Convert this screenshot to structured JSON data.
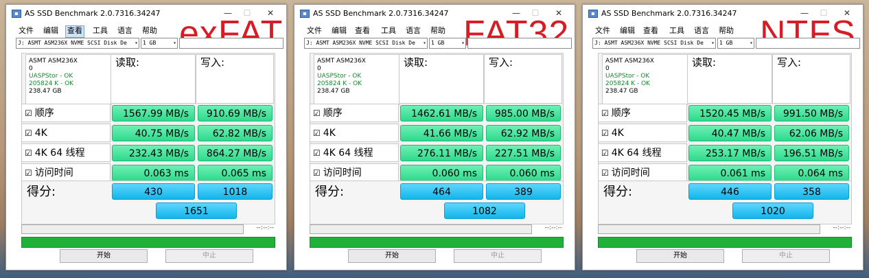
{
  "windows": [
    {
      "title": "AS SSD Benchmark 2.0.7316.34247",
      "menu": [
        "文件",
        "编辑",
        "查看",
        "工具",
        "语言",
        "帮助"
      ],
      "active_menu_index": 2,
      "label": "exFAT",
      "drive_select": "J: ASMT ASM236X NVME SCSI Disk De",
      "size_select": "1 GB",
      "device": {
        "name": "ASMT ASM236X",
        "line2": "0",
        "driver": "UASPStor - OK",
        "align": "205824 K - OK",
        "capacity": "238.47 GB"
      },
      "col_read": "读取:",
      "col_write": "写入:",
      "rows": [
        {
          "check": "☑",
          "label": "顺序",
          "read": "1567.99 MB/s",
          "write": "910.69 MB/s"
        },
        {
          "check": "☑",
          "label": "4K",
          "read": "40.75 MB/s",
          "write": "62.82 MB/s"
        },
        {
          "check": "☑",
          "label": "4K 64 线程",
          "read": "232.43 MB/s",
          "write": "864.27 MB/s"
        },
        {
          "check": "☑",
          "label": "访问时间",
          "read": "0.063 ms",
          "write": "0.065 ms"
        }
      ],
      "score_label": "得分:",
      "score_read": "430",
      "score_write": "1018",
      "score_total": "1651",
      "timer": "--:--:--",
      "start_button": "开始",
      "stop_button": "中止"
    },
    {
      "title": "AS SSD Benchmark 2.0.7316.34247",
      "menu": [
        "文件",
        "编辑",
        "查看",
        "工具",
        "语言",
        "帮助"
      ],
      "active_menu_index": -1,
      "label": "FAT32",
      "drive_select": "J: ASMT ASM236X NVME SCSI Disk De",
      "size_select": "1 GB",
      "device": {
        "name": "ASMT ASM236X",
        "line2": "0",
        "driver": "UASPStor - OK",
        "align": "205824 K - OK",
        "capacity": "238.47 GB"
      },
      "col_read": "读取:",
      "col_write": "写入:",
      "rows": [
        {
          "check": "☑",
          "label": "顺序",
          "read": "1462.61 MB/s",
          "write": "985.00 MB/s"
        },
        {
          "check": "☑",
          "label": "4K",
          "read": "41.66 MB/s",
          "write": "62.92 MB/s"
        },
        {
          "check": "☑",
          "label": "4K 64 线程",
          "read": "276.11 MB/s",
          "write": "227.51 MB/s"
        },
        {
          "check": "☑",
          "label": "访问时间",
          "read": "0.060 ms",
          "write": "0.060 ms"
        }
      ],
      "score_label": "得分:",
      "score_read": "464",
      "score_write": "389",
      "score_total": "1082",
      "timer": "--:--:--",
      "start_button": "开始",
      "stop_button": "中止"
    },
    {
      "title": "AS SSD Benchmark 2.0.7316.34247",
      "menu": [
        "文件",
        "编辑",
        "查看",
        "工具",
        "语言",
        "帮助"
      ],
      "active_menu_index": -1,
      "label": "NTFS",
      "drive_select": "J: ASMT ASM236X NVME SCSI Disk De",
      "size_select": "1 GB",
      "device": {
        "name": "ASMT ASM236X",
        "line2": "0",
        "driver": "UASPStor - OK",
        "align": "205824 K - OK",
        "capacity": "238.47 GB"
      },
      "col_read": "读取:",
      "col_write": "写入:",
      "rows": [
        {
          "check": "☑",
          "label": "顺序",
          "read": "1520.45 MB/s",
          "write": "991.50 MB/s"
        },
        {
          "check": "☑",
          "label": "4K",
          "read": "40.47 MB/s",
          "write": "62.06 MB/s"
        },
        {
          "check": "☑",
          "label": "4K 64 线程",
          "read": "253.17 MB/s",
          "write": "196.51 MB/s"
        },
        {
          "check": "☑",
          "label": "访问时间",
          "read": "0.061 ms",
          "write": "0.064 ms"
        }
      ],
      "score_label": "得分:",
      "score_read": "446",
      "score_write": "358",
      "score_total": "1020",
      "timer": "--:--:--",
      "start_button": "开始",
      "stop_button": "中止"
    }
  ],
  "colors": {
    "label_red": "#d81c25",
    "result_green": "#2fd98c",
    "score_blue": "#12b5ea",
    "progress_green": "#1fb13a"
  }
}
